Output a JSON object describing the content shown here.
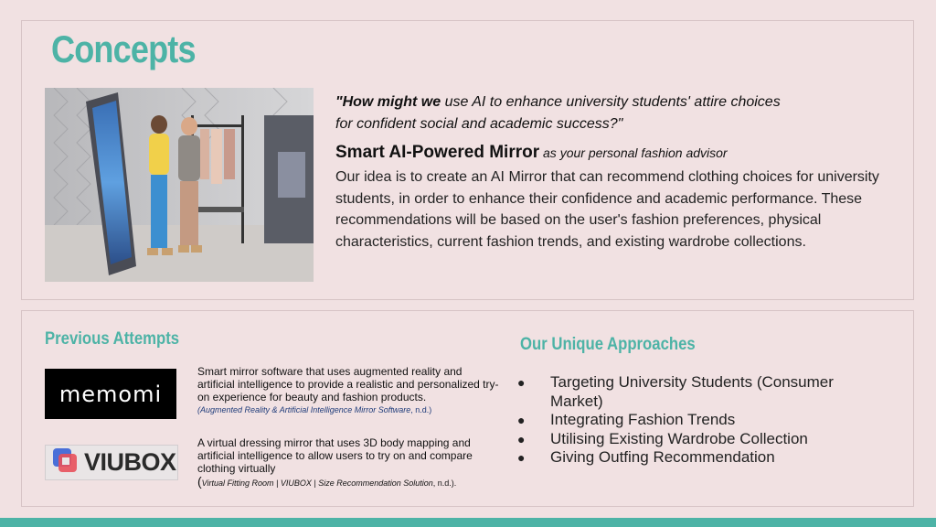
{
  "title": "Concepts",
  "question": {
    "lead": "\"How might we",
    "rest": " use AI to enhance university students' attire choices",
    "line2": "for confident social and academic success?\""
  },
  "mirror": {
    "name": "Smart AI-Powered Mirror",
    "subtitle": " as your personal fashion advisor",
    "description": "Our idea is to create an AI Mirror that can recommend clothing choices for university students, in order to enhance their confidence and academic performance. These recommendations will be based on the user's fashion preferences, physical characteristics, current fashion trends, and existing wardrobe collections."
  },
  "previous": {
    "heading": "Previous Attempts",
    "memomi": {
      "logo_text": "memomi",
      "description": "Smart mirror software that uses augmented reality and artificial intelligence to provide a realistic and personalized try-on experience for beauty and fashion products.",
      "cite_open": "(",
      "cite_title": "Augmented Reality & Artificial Intelligence Mirror Software",
      "cite_tail": ", n.d.)"
    },
    "viubox": {
      "logo_text": "VIUBOX",
      "description": "A virtual dressing mirror that uses 3D body mapping and artificial intelligence to allow users to try on and compare clothing virtually",
      "cite_open": "(",
      "cite_title": "Virtual Fitting Room | VIUBOX | Size Recommendation Solution",
      "cite_tail": ", n.d.)."
    }
  },
  "unique": {
    "heading": "Our Unique Approaches",
    "bullet": "●",
    "items": [
      "Targeting University Students (Consumer Market)",
      "Integrating Fashion Trends",
      "Utilising Existing Wardrobe Collection",
      "Giving Outfing Recommendation"
    ]
  },
  "colors": {
    "accent": "#4db3a6",
    "background": "#f1e1e2",
    "citation": "#1f3c7a"
  },
  "icons": [
    "viubox-mark-icon"
  ]
}
